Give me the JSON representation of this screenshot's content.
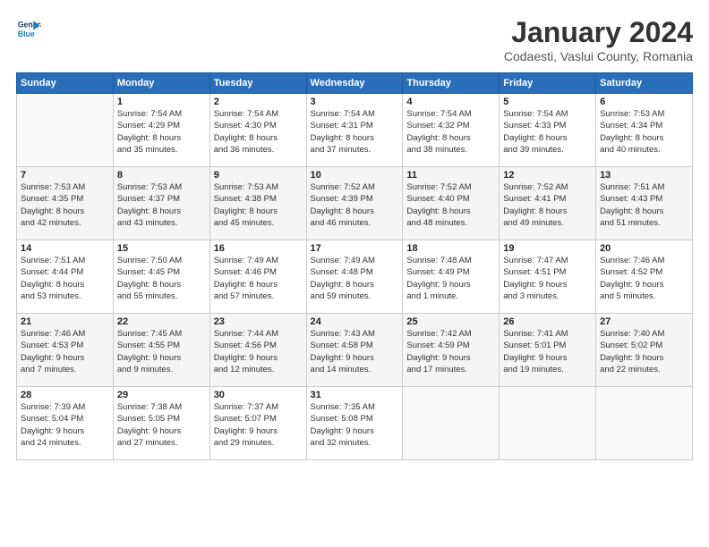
{
  "app": {
    "name_line1": "General",
    "name_line2": "Blue"
  },
  "header": {
    "month": "January 2024",
    "location": "Codaesti, Vaslui County, Romania"
  },
  "weekdays": [
    "Sunday",
    "Monday",
    "Tuesday",
    "Wednesday",
    "Thursday",
    "Friday",
    "Saturday"
  ],
  "weeks": [
    [
      {
        "day": "",
        "info": ""
      },
      {
        "day": "1",
        "info": "Sunrise: 7:54 AM\nSunset: 4:29 PM\nDaylight: 8 hours\nand 35 minutes."
      },
      {
        "day": "2",
        "info": "Sunrise: 7:54 AM\nSunset: 4:30 PM\nDaylight: 8 hours\nand 36 minutes."
      },
      {
        "day": "3",
        "info": "Sunrise: 7:54 AM\nSunset: 4:31 PM\nDaylight: 8 hours\nand 37 minutes."
      },
      {
        "day": "4",
        "info": "Sunrise: 7:54 AM\nSunset: 4:32 PM\nDaylight: 8 hours\nand 38 minutes."
      },
      {
        "day": "5",
        "info": "Sunrise: 7:54 AM\nSunset: 4:33 PM\nDaylight: 8 hours\nand 39 minutes."
      },
      {
        "day": "6",
        "info": "Sunrise: 7:53 AM\nSunset: 4:34 PM\nDaylight: 8 hours\nand 40 minutes."
      }
    ],
    [
      {
        "day": "7",
        "info": "Sunrise: 7:53 AM\nSunset: 4:35 PM\nDaylight: 8 hours\nand 42 minutes."
      },
      {
        "day": "8",
        "info": "Sunrise: 7:53 AM\nSunset: 4:37 PM\nDaylight: 8 hours\nand 43 minutes."
      },
      {
        "day": "9",
        "info": "Sunrise: 7:53 AM\nSunset: 4:38 PM\nDaylight: 8 hours\nand 45 minutes."
      },
      {
        "day": "10",
        "info": "Sunrise: 7:52 AM\nSunset: 4:39 PM\nDaylight: 8 hours\nand 46 minutes."
      },
      {
        "day": "11",
        "info": "Sunrise: 7:52 AM\nSunset: 4:40 PM\nDaylight: 8 hours\nand 48 minutes."
      },
      {
        "day": "12",
        "info": "Sunrise: 7:52 AM\nSunset: 4:41 PM\nDaylight: 8 hours\nand 49 minutes."
      },
      {
        "day": "13",
        "info": "Sunrise: 7:51 AM\nSunset: 4:43 PM\nDaylight: 8 hours\nand 51 minutes."
      }
    ],
    [
      {
        "day": "14",
        "info": "Sunrise: 7:51 AM\nSunset: 4:44 PM\nDaylight: 8 hours\nand 53 minutes."
      },
      {
        "day": "15",
        "info": "Sunrise: 7:50 AM\nSunset: 4:45 PM\nDaylight: 8 hours\nand 55 minutes."
      },
      {
        "day": "16",
        "info": "Sunrise: 7:49 AM\nSunset: 4:46 PM\nDaylight: 8 hours\nand 57 minutes."
      },
      {
        "day": "17",
        "info": "Sunrise: 7:49 AM\nSunset: 4:48 PM\nDaylight: 8 hours\nand 59 minutes."
      },
      {
        "day": "18",
        "info": "Sunrise: 7:48 AM\nSunset: 4:49 PM\nDaylight: 9 hours\nand 1 minute."
      },
      {
        "day": "19",
        "info": "Sunrise: 7:47 AM\nSunset: 4:51 PM\nDaylight: 9 hours\nand 3 minutes."
      },
      {
        "day": "20",
        "info": "Sunrise: 7:46 AM\nSunset: 4:52 PM\nDaylight: 9 hours\nand 5 minutes."
      }
    ],
    [
      {
        "day": "21",
        "info": "Sunrise: 7:46 AM\nSunset: 4:53 PM\nDaylight: 9 hours\nand 7 minutes."
      },
      {
        "day": "22",
        "info": "Sunrise: 7:45 AM\nSunset: 4:55 PM\nDaylight: 9 hours\nand 9 minutes."
      },
      {
        "day": "23",
        "info": "Sunrise: 7:44 AM\nSunset: 4:56 PM\nDaylight: 9 hours\nand 12 minutes."
      },
      {
        "day": "24",
        "info": "Sunrise: 7:43 AM\nSunset: 4:58 PM\nDaylight: 9 hours\nand 14 minutes."
      },
      {
        "day": "25",
        "info": "Sunrise: 7:42 AM\nSunset: 4:59 PM\nDaylight: 9 hours\nand 17 minutes."
      },
      {
        "day": "26",
        "info": "Sunrise: 7:41 AM\nSunset: 5:01 PM\nDaylight: 9 hours\nand 19 minutes."
      },
      {
        "day": "27",
        "info": "Sunrise: 7:40 AM\nSunset: 5:02 PM\nDaylight: 9 hours\nand 22 minutes."
      }
    ],
    [
      {
        "day": "28",
        "info": "Sunrise: 7:39 AM\nSunset: 5:04 PM\nDaylight: 9 hours\nand 24 minutes."
      },
      {
        "day": "29",
        "info": "Sunrise: 7:38 AM\nSunset: 5:05 PM\nDaylight: 9 hours\nand 27 minutes."
      },
      {
        "day": "30",
        "info": "Sunrise: 7:37 AM\nSunset: 5:07 PM\nDaylight: 9 hours\nand 29 minutes."
      },
      {
        "day": "31",
        "info": "Sunrise: 7:35 AM\nSunset: 5:08 PM\nDaylight: 9 hours\nand 32 minutes."
      },
      {
        "day": "",
        "info": ""
      },
      {
        "day": "",
        "info": ""
      },
      {
        "day": "",
        "info": ""
      }
    ]
  ]
}
